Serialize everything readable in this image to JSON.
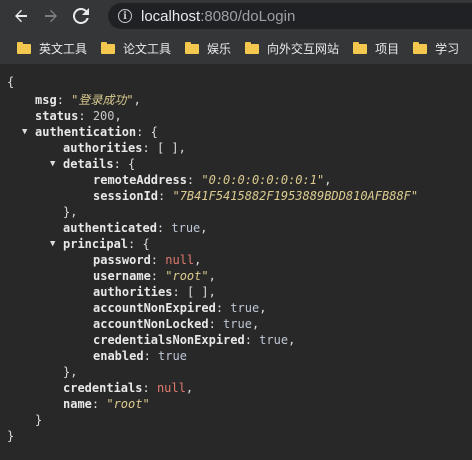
{
  "toolbar": {
    "back_icon": "arrow-left-icon",
    "forward_icon": "arrow-right-icon",
    "reload_icon": "reload-icon",
    "url_host": "localhost",
    "url_rest": ":8080/doLogin"
  },
  "bookmarks": [
    {
      "label": "英文工具"
    },
    {
      "label": "论文工具"
    },
    {
      "label": "娱乐"
    },
    {
      "label": "向外交互网站"
    },
    {
      "label": "项目"
    },
    {
      "label": "学习"
    }
  ],
  "json": {
    "open_brace": "{",
    "close_brace": "}",
    "msg_key": "msg",
    "msg_val": "\"登录成功\"",
    "status_key": "status",
    "status_val": "200",
    "authentication_key": "authentication",
    "authorities_key": "authorities",
    "authorities_val": "[ ]",
    "details_key": "details",
    "remoteAddress_key": "remoteAddress",
    "remoteAddress_val": "\"0:0:0:0:0:0:0:1\"",
    "sessionId_key": "sessionId",
    "sessionId_val": "\"7B41F5415882F1953889BDD810AFB88F\"",
    "authenticated_key": "authenticated",
    "authenticated_val": "true",
    "principal_key": "principal",
    "password_key": "password",
    "password_val": "null",
    "username_key": "username",
    "username_val": "\"root\"",
    "p_authorities_key": "authorities",
    "p_authorities_val": "[ ]",
    "accountNonExpired_key": "accountNonExpired",
    "accountNonExpired_val": "true",
    "accountNonLocked_key": "accountNonLocked",
    "accountNonLocked_val": "true",
    "credentialsNonExpired_key": "credentialsNonExpired",
    "credentialsNonExpired_val": "true",
    "enabled_key": "enabled",
    "enabled_val": "true",
    "credentials_key": "credentials",
    "credentials_val": "null",
    "name_key": "name",
    "name_val": "\"root\""
  }
}
